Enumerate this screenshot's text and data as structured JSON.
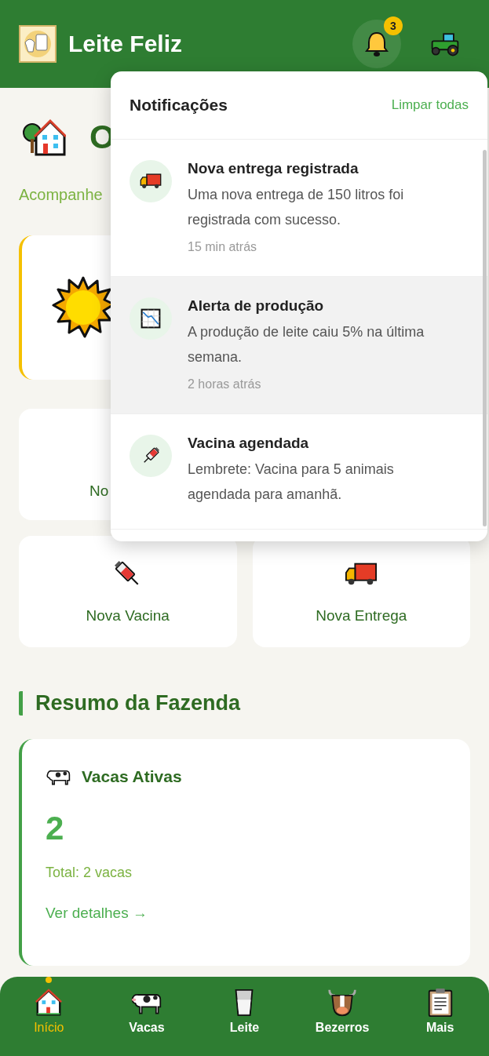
{
  "header": {
    "title": "Leite Feliz",
    "notification_count": "3"
  },
  "page": {
    "title": "O",
    "subtitle": "Acompanhe"
  },
  "quick_actions": [
    {
      "label": "No"
    },
    {
      "label": "Nova Vacina",
      "kind": "syringe"
    },
    {
      "label": "Nova Entrega",
      "kind": "truck"
    }
  ],
  "summary": {
    "title": "Resumo da Fazenda",
    "card": {
      "title": "Vacas Ativas",
      "value": "2",
      "total": "Total: 2 vacas",
      "link": "Ver detalhes →"
    }
  },
  "notifications": {
    "title": "Notificações",
    "clear": "Limpar todas",
    "items": [
      {
        "kind": "truck",
        "title": "Nova entrega registrada",
        "text": "Uma nova entrega de 150 litros foi registrada com sucesso.",
        "time": "15 min atrás",
        "unread": false
      },
      {
        "kind": "chart",
        "title": "Alerta de produção",
        "text": "A produção de leite caiu 5% na última semana.",
        "time": "2 horas atrás",
        "unread": true
      },
      {
        "kind": "syringe",
        "title": "Vacina agendada",
        "text": "Lembrete: Vacina para 5 animais agendada para amanhã.",
        "unread": false
      }
    ]
  },
  "bottom_nav": [
    {
      "label": "Início",
      "kind": "house",
      "selected": true
    },
    {
      "label": "Vacas",
      "kind": "cow",
      "selected": false
    },
    {
      "label": "Leite",
      "kind": "milk",
      "selected": false
    },
    {
      "label": "Bezerros",
      "kind": "bull",
      "selected": false
    },
    {
      "label": "Mais",
      "kind": "clipboard",
      "selected": false
    }
  ]
}
